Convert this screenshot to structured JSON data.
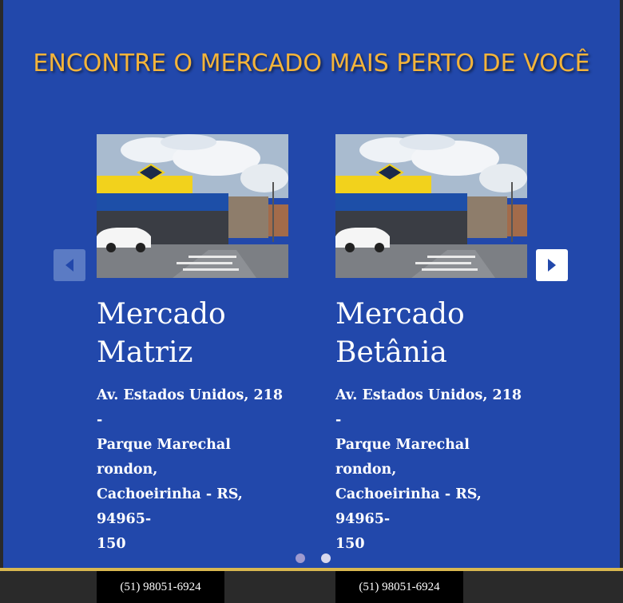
{
  "header": {
    "title": "ENCONTRE O MERCADO MAIS PERTO DE VOCÊ"
  },
  "colors": {
    "background": "#2248ab",
    "title": "#f4b43a",
    "button": "#000000",
    "accent_bar": "#d9b850"
  },
  "carousel": {
    "prev_icon": "chevron-left-icon",
    "next_icon": "chevron-right-icon",
    "stores": [
      {
        "name_line1": "Mercado",
        "name_line2": "Matriz",
        "address_line1": "Av. Estados Unidos, 218 -",
        "address_line2": "Parque Marechal rondon,",
        "address_line3": "Cachoeirinha - RS, 94965-",
        "address_line4": "150",
        "phone": "(51) 98051-6924"
      },
      {
        "name_line1": "Mercado",
        "name_line2": "Betânia",
        "address_line1": "Av. Estados Unidos, 218 -",
        "address_line2": "Parque Marechal rondon,",
        "address_line3": "Cachoeirinha - RS, 94965-",
        "address_line4": "150",
        "phone": "(51) 98051-6924"
      }
    ],
    "dots": 2,
    "active_dot": 1
  }
}
